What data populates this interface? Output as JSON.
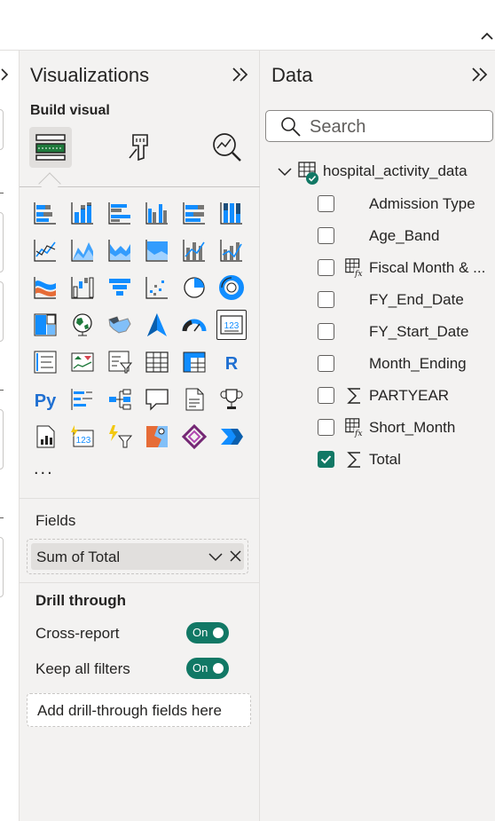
{
  "visualizations": {
    "title": "Visualizations",
    "build_visual_label": "Build visual",
    "more_label": "...",
    "fields_label": "Fields",
    "field_value": "Sum of Total",
    "drill_through_label": "Drill through",
    "cross_report_label": "Cross-report",
    "cross_report_state": "On",
    "keep_filters_label": "Keep all filters",
    "keep_filters_state": "On",
    "drill_placeholder": "Add drill-through fields here"
  },
  "data_pane": {
    "title": "Data",
    "search_placeholder": "Search",
    "table_name": "hospital_activity_data",
    "fields": [
      {
        "name": "Admission Type",
        "icon": "none",
        "checked": false
      },
      {
        "name": "Age_Band",
        "icon": "none",
        "checked": false
      },
      {
        "name": "Fiscal Month & ...",
        "icon": "calc-table-icon",
        "checked": false
      },
      {
        "name": "FY_End_Date",
        "icon": "none",
        "checked": false
      },
      {
        "name": "FY_Start_Date",
        "icon": "none",
        "checked": false
      },
      {
        "name": "Month_Ending",
        "icon": "none",
        "checked": false
      },
      {
        "name": "PARTYEAR",
        "icon": "sigma-icon",
        "checked": false
      },
      {
        "name": "Short_Month",
        "icon": "calc-table-icon",
        "checked": false
      },
      {
        "name": "Total",
        "icon": "sigma-icon",
        "checked": true
      }
    ]
  },
  "colors": {
    "accent": "#117865",
    "chart_blue": "#118dff",
    "border": "#e1dfdd"
  }
}
